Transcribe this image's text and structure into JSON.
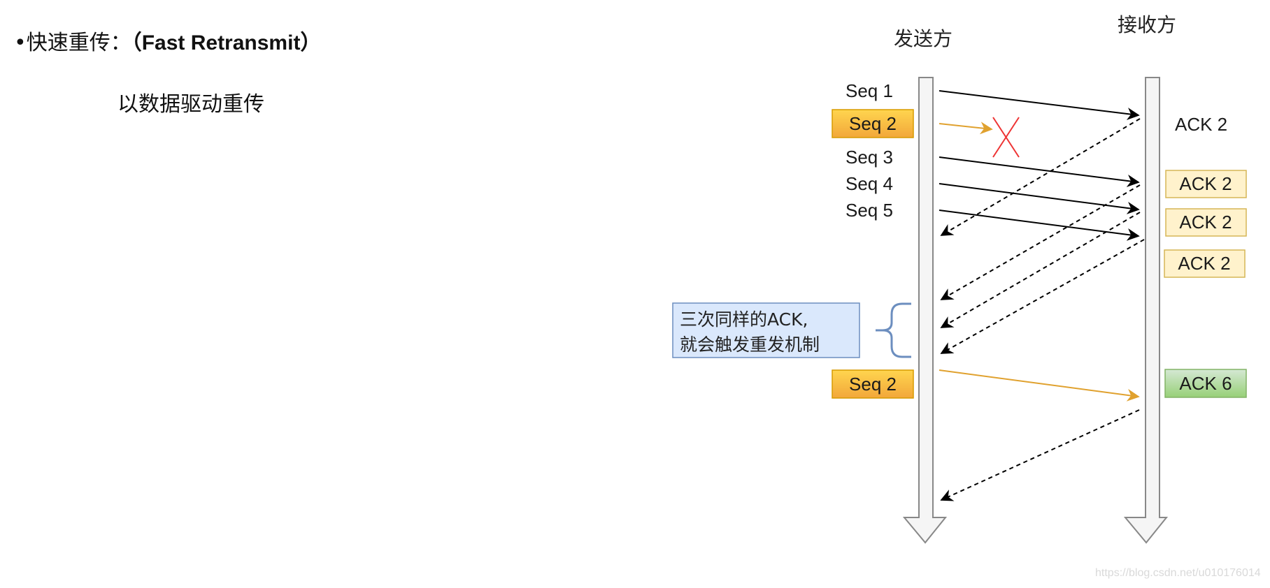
{
  "slide": {
    "title_bullet": "•",
    "title_cn": "快速重传：",
    "title_en": "（Fast Retransmit）",
    "subtitle": "以数据驱动重传"
  },
  "diagram": {
    "sender_label": "发送方",
    "receiver_label": "接收方",
    "sender_messages": [
      {
        "label": "Seq 1",
        "style": "plain"
      },
      {
        "label": "Seq 2",
        "style": "highlight-orange",
        "lost": true
      },
      {
        "label": "Seq 3",
        "style": "plain"
      },
      {
        "label": "Seq 4",
        "style": "plain"
      },
      {
        "label": "Seq 5",
        "style": "plain"
      },
      {
        "label": "Seq 2",
        "style": "highlight-orange",
        "retransmit": true
      }
    ],
    "receiver_acks": [
      {
        "label": "ACK 2",
        "style": "plain"
      },
      {
        "label": "ACK 2",
        "style": "highlight-yellow"
      },
      {
        "label": "ACK 2",
        "style": "highlight-yellow"
      },
      {
        "label": "ACK 2",
        "style": "highlight-yellow"
      },
      {
        "label": "ACK 6",
        "style": "highlight-green"
      }
    ],
    "note_line1": "三次同样的ACK,",
    "note_line2": "就会触发重发机制",
    "colors": {
      "orange_fill_top": "#ffd54f",
      "orange_fill_bottom": "#f2a73a",
      "orange_border": "#d79b00",
      "orange_arrow": "#e0a12e",
      "yellow_fill": "#fff2cc",
      "yellow_border": "#d6b656",
      "green_fill_top": "#d5e8d4",
      "green_fill_bottom": "#97d077",
      "green_border": "#82b366",
      "note_fill": "#dae8fc",
      "note_border": "#6c8ebf",
      "lost_mark": "#ee3333",
      "lifeline_fill": "#f5f5f5",
      "lifeline_border": "#888888"
    }
  },
  "watermark": "https://blog.csdn.net/u010176014"
}
